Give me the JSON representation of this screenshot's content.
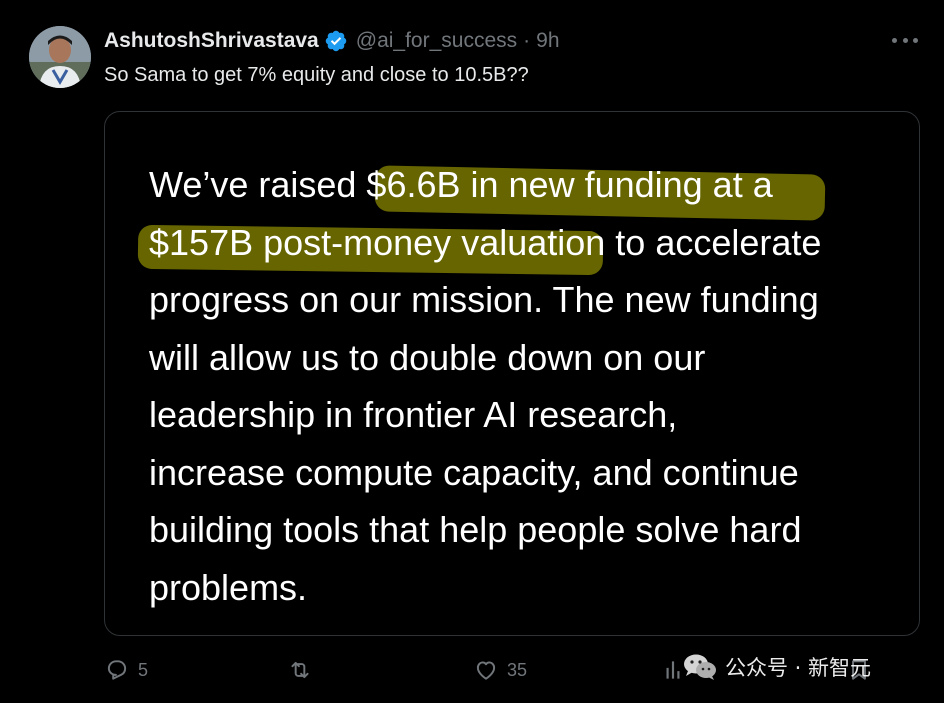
{
  "author": {
    "display_name": "AshutoshShrivastava",
    "handle": "@ai_for_success",
    "separator": "·",
    "time": "9h",
    "verified_color": "#1d9bf0"
  },
  "tweet": {
    "text": "So Sama to get 7% equity and close to 10.5B??"
  },
  "card": {
    "lines": [
      "We’ve raised $6.6B in new funding at a",
      "$157B post-money valuation to accelerate",
      "progress on our mission. The new funding",
      "will allow us to double down on our",
      "leadership in frontier AI research,",
      "increase compute capacity, and continue",
      "building tools that help people solve hard",
      "problems."
    ],
    "highlight_color": "#6b6a00"
  },
  "actions": {
    "reply_count": "5",
    "retweet_count": "",
    "like_count": "35",
    "views_count": "",
    "icons": [
      "reply-icon",
      "retweet-icon",
      "like-icon",
      "views-icon",
      "bookmark-icon"
    ]
  },
  "watermark": {
    "text": "公众号 · 新智元",
    "icon": "wechat-icon"
  },
  "colors": {
    "background": "#000000",
    "text": "#e7e9ea",
    "muted": "#71767b",
    "border": "#2f3336"
  }
}
